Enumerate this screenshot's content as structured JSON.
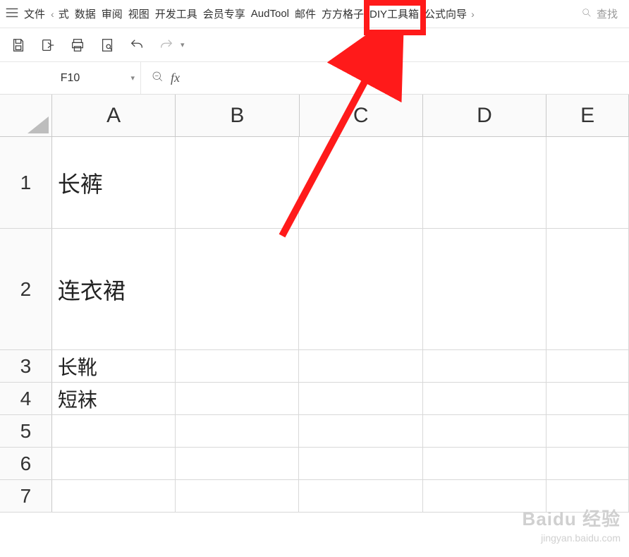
{
  "menu": {
    "file": "文件",
    "tabs": [
      "式",
      "数据",
      "审阅",
      "视图",
      "开发工具",
      "会员专享",
      "AudTool",
      "邮件",
      "方方格子",
      "DIY工具箱",
      "公式向导"
    ],
    "scroll_left": "‹",
    "scroll_right": "›",
    "search_placeholder": "查找"
  },
  "namebox": {
    "value": "F10"
  },
  "fx": {
    "label": "fx",
    "formula": ""
  },
  "columns": [
    "A",
    "B",
    "C",
    "D",
    "E"
  ],
  "rows": [
    {
      "n": "1",
      "cells": [
        "长裤",
        "",
        "",
        "",
        ""
      ]
    },
    {
      "n": "2",
      "cells": [
        "连衣裙",
        "",
        "",
        "",
        ""
      ]
    },
    {
      "n": "3",
      "cells": [
        "长靴",
        "",
        "",
        "",
        ""
      ]
    },
    {
      "n": "4",
      "cells": [
        "短袜",
        "",
        "",
        "",
        ""
      ]
    },
    {
      "n": "5",
      "cells": [
        "",
        "",
        "",
        "",
        ""
      ]
    },
    {
      "n": "6",
      "cells": [
        "",
        "",
        "",
        "",
        ""
      ]
    },
    {
      "n": "7",
      "cells": [
        "",
        "",
        "",
        "",
        ""
      ]
    }
  ],
  "annotation": {
    "highlight_tab_index": 8,
    "color": "#ff1a1a"
  },
  "watermark": {
    "line1": "Baidu 经验",
    "line2": "jingyan.baidu.com"
  }
}
